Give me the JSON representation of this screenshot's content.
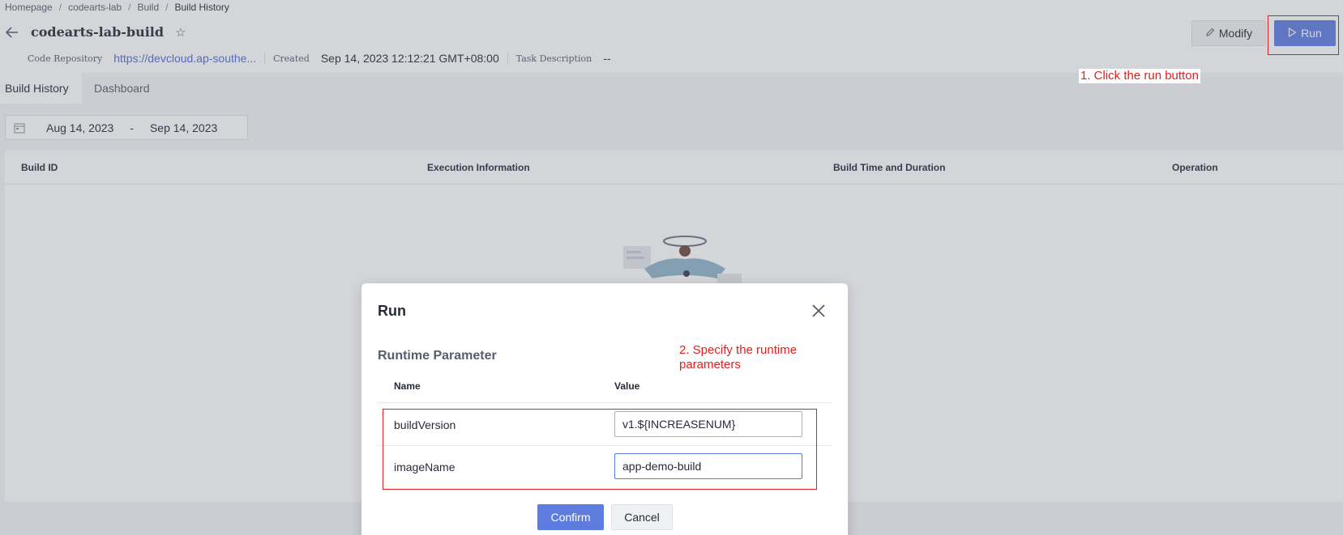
{
  "breadcrumb": {
    "items": [
      "Homepage",
      "codearts-lab",
      "Build"
    ],
    "separator": "/",
    "current": "Build History"
  },
  "job": {
    "title": "codearts-lab-build"
  },
  "meta": {
    "repo_label": "Code Repository",
    "repo_value": "https://devcloud.ap-southe...",
    "created_label": "Created",
    "created_value": "Sep 14, 2023 12:12:21 GMT+08:00",
    "desc_label": "Task Description",
    "desc_value": "--"
  },
  "header_buttons": {
    "modify": "Modify",
    "run": "Run"
  },
  "annotations": {
    "step1": "1. Click the run button",
    "step2": "2. Specify the runtime parameters"
  },
  "tabs": {
    "build_history": "Build History",
    "dashboard": "Dashboard"
  },
  "date_range": {
    "start": "Aug 14, 2023",
    "separator": "-",
    "end": "Sep 14, 2023"
  },
  "table": {
    "headers": [
      "Build ID",
      "Execution Information",
      "Build Time and Duration",
      "Operation"
    ]
  },
  "dialog": {
    "title": "Run",
    "section_title": "Runtime Parameter",
    "col_name": "Name",
    "col_value": "Value",
    "params": [
      {
        "name": "buildVersion",
        "value": "v1.${INCREASENUM}"
      },
      {
        "name": "imageName",
        "value": "app-demo-build"
      }
    ],
    "confirm": "Confirm",
    "cancel": "Cancel"
  },
  "colors": {
    "primary": "#5e7ce0",
    "annotation_red": "#e02020",
    "link": "#526ecc"
  },
  "icons": [
    "back-arrow-icon",
    "star-icon",
    "pencil-icon",
    "play-icon",
    "calendar-icon",
    "close-icon"
  ]
}
